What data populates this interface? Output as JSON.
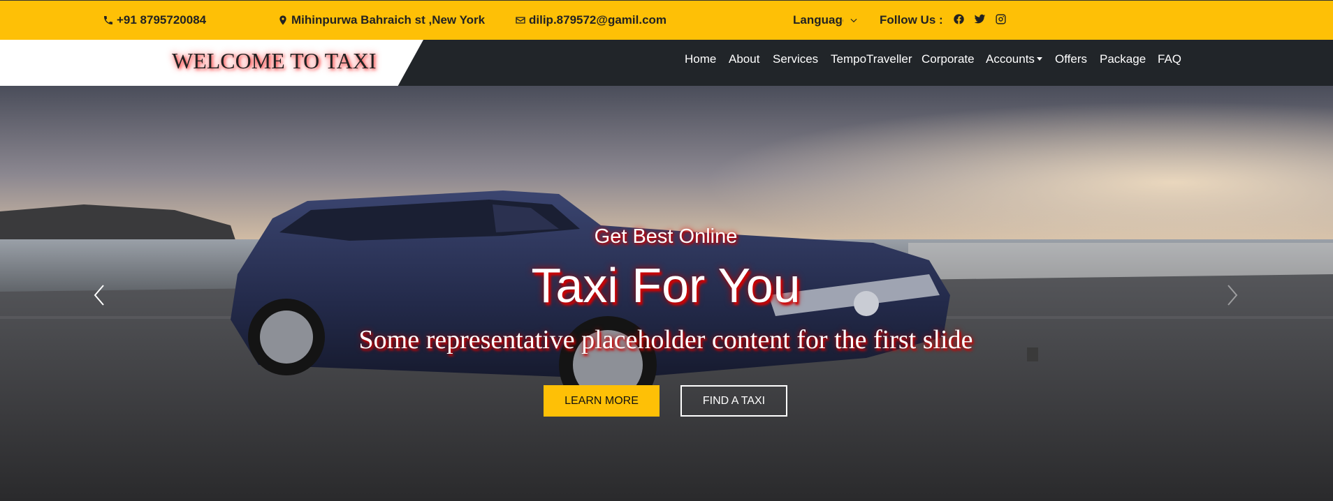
{
  "topbar": {
    "phone": "+91 8795720084",
    "address": "Mihinpurwa Bahraich st ,New York",
    "email": "dilip.879572@gamil.com",
    "language_label": "Language",
    "follow_label": "Follow Us :",
    "icons": {
      "phone": "phone-icon",
      "address": "map-marker-icon",
      "email": "envelope-icon",
      "language": "chevron-down-icon",
      "social": [
        "facebook-icon",
        "twitter-icon",
        "instagram-icon"
      ]
    }
  },
  "navbar": {
    "brand": "WELCOME TO TAXI",
    "links": [
      "Home",
      "About",
      "Services",
      "TempoTraveller",
      "Corporate",
      "Accounts",
      "Offers",
      "Package",
      "FAQ"
    ]
  },
  "hero": {
    "eyebrow": "Get Best Online",
    "headline": "Taxi For You",
    "subline": "Some representative placeholder content for the first slide",
    "learn_more": "LEARN MORE",
    "find_taxi": "FIND A TAXI",
    "icons": {
      "prev": "chevron-left-icon",
      "next": "chevron-right-icon"
    }
  },
  "colors": {
    "accent": "#fec006",
    "navbar_bg": "#212529",
    "text_dark": "#222222",
    "headline_shadow": "#d40000"
  }
}
